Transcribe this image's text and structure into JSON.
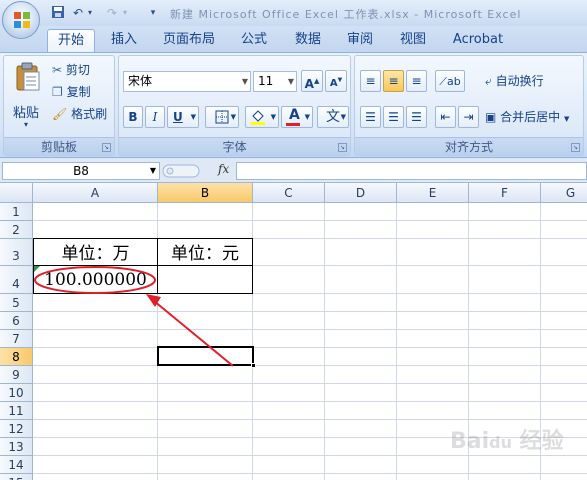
{
  "title_bar": {
    "title": "新建 Microsoft Office Excel 工作表.xlsx - Microsoft Excel"
  },
  "ribbon_tabs": [
    {
      "label": "开始",
      "active": true
    },
    {
      "label": "插入",
      "active": false
    },
    {
      "label": "页面布局",
      "active": false
    },
    {
      "label": "公式",
      "active": false
    },
    {
      "label": "数据",
      "active": false
    },
    {
      "label": "审阅",
      "active": false
    },
    {
      "label": "视图",
      "active": false
    },
    {
      "label": "Acrobat",
      "active": false
    }
  ],
  "clipboard": {
    "paste": "粘贴",
    "cut": "剪切",
    "copy": "复制",
    "format_painter": "格式刷",
    "label": "剪贴板"
  },
  "font": {
    "name": "宋体",
    "size": "11",
    "bold": "B",
    "italic": "I",
    "underline": "U",
    "font_color_letter": "A",
    "phonetic": "文",
    "label": "字体"
  },
  "alignment": {
    "wrap_text": "自动换行",
    "merge_center": "合并后居中",
    "label": "对齐方式"
  },
  "formula_bar": {
    "name_box": "B8",
    "fx": "fx",
    "formula": ""
  },
  "sheet": {
    "columns": [
      "A",
      "B",
      "C",
      "D",
      "E",
      "F",
      "G"
    ],
    "rows": [
      "1",
      "2",
      "3",
      "4",
      "5",
      "6",
      "7",
      "8",
      "9",
      "10",
      "11",
      "12",
      "13",
      "14",
      "15"
    ],
    "selected_column": "B",
    "selected_row": "8",
    "cells": {
      "A3": "单位：万",
      "B3": "单位：元",
      "A4": "100.000000"
    }
  },
  "colors": {
    "annotation": "#e0202a",
    "selection_header": "#f9c96a"
  }
}
